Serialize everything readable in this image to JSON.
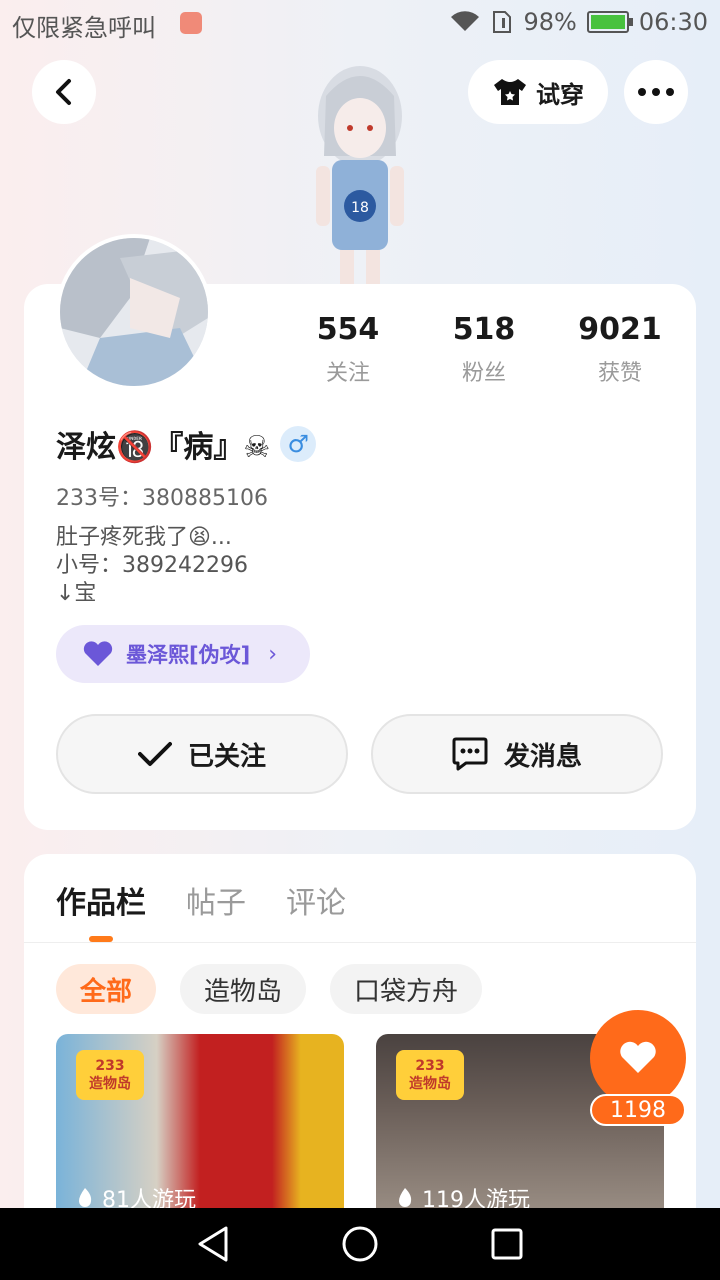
{
  "status_bar": {
    "left_text": "仅限紧急呼叫",
    "battery": "98%",
    "time": "06:30"
  },
  "header": {
    "try_on_label": "试穿"
  },
  "profile": {
    "stats": [
      {
        "value": "554",
        "label": "关注"
      },
      {
        "value": "518",
        "label": "粉丝"
      },
      {
        "value": "9021",
        "label": "获赞"
      }
    ],
    "name": "泽炫🔞『病』☠",
    "gender_symbol": "♂",
    "uid": "233号：380885106",
    "bio": [
      "肚子疼死我了😫...",
      "小号：389242296",
      "↓宝"
    ],
    "relation_tag": "墨泽熙[伪攻]",
    "follow_button": "已关注",
    "message_button": "发消息"
  },
  "works": {
    "tabs": [
      "作品栏",
      "帖子",
      "评论"
    ],
    "active_tab": 0,
    "filters": [
      "全部",
      "造物岛",
      "口袋方舟"
    ],
    "active_filter": 0,
    "items": [
      {
        "badge": "233\n造物岛",
        "plays": "81人游玩"
      },
      {
        "badge": "233\n造物岛",
        "plays": "119人游玩"
      }
    ],
    "like_count": "1198"
  },
  "colors": {
    "accent": "#ff6a1a",
    "tag_purple": "#6b57d8"
  }
}
